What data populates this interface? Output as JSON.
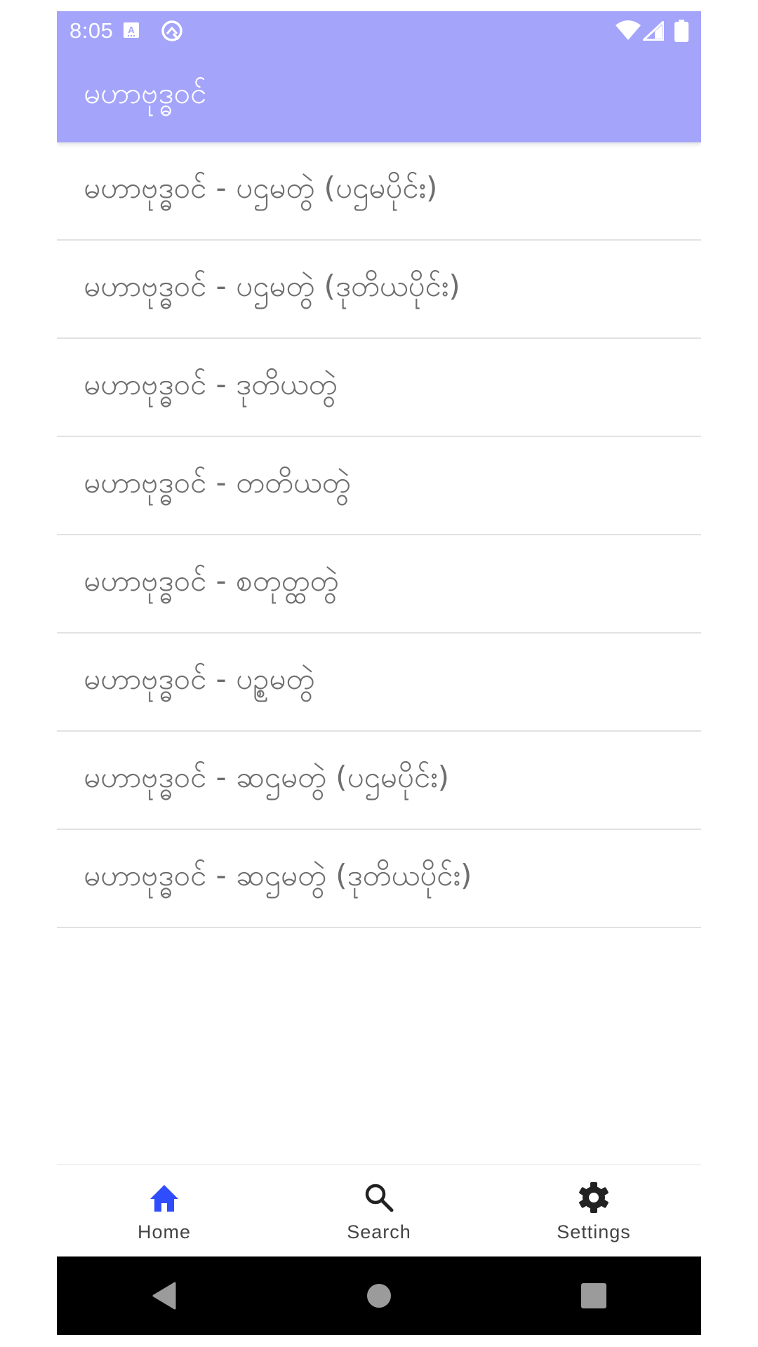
{
  "status_bar": {
    "time": "8:05",
    "icons": [
      "accessibility-a-icon",
      "android-q-icon",
      "wifi-icon",
      "cell-signal-icon",
      "battery-icon"
    ]
  },
  "app_bar": {
    "title": "မဟာဗုဒ္ဓဝင်",
    "background_color": "#a4a4fb"
  },
  "list": {
    "items": [
      {
        "label": "မဟာဗုဒ္ဓဝင် - ပဌမတွဲ (ပဌမပိုင်း)"
      },
      {
        "label": "မဟာဗုဒ္ဓဝင် - ပဌမတွဲ (ဒုတိယပိုင်း)"
      },
      {
        "label": "မဟာဗုဒ္ဓဝင် - ဒုတိယတွဲ"
      },
      {
        "label": "မဟာဗုဒ္ဓဝင် - တတိယတွဲ"
      },
      {
        "label": "မဟာဗုဒ္ဓဝင် - စတုတ္ထတွဲ"
      },
      {
        "label": "မဟာဗုဒ္ဓဝင် - ပဉ္စမတွဲ"
      },
      {
        "label": "မဟာဗုဒ္ဓဝင် - ဆဌမတွဲ (ပဌမပိုင်း)"
      },
      {
        "label": "မဟာဗုဒ္ဓဝင် - ဆဌမတွဲ (ဒုတိယပိုင်း)"
      }
    ]
  },
  "bottom_nav": {
    "active_color": "#2f4dfc",
    "inactive_color": "#222222",
    "items": [
      {
        "label": "Home",
        "icon": "home-icon",
        "active": true
      },
      {
        "label": "Search",
        "icon": "search-icon",
        "active": false
      },
      {
        "label": "Settings",
        "icon": "gear-icon",
        "active": false
      }
    ]
  },
  "system_nav": {
    "buttons": [
      "back-icon",
      "home-circle-icon",
      "recents-icon"
    ]
  }
}
